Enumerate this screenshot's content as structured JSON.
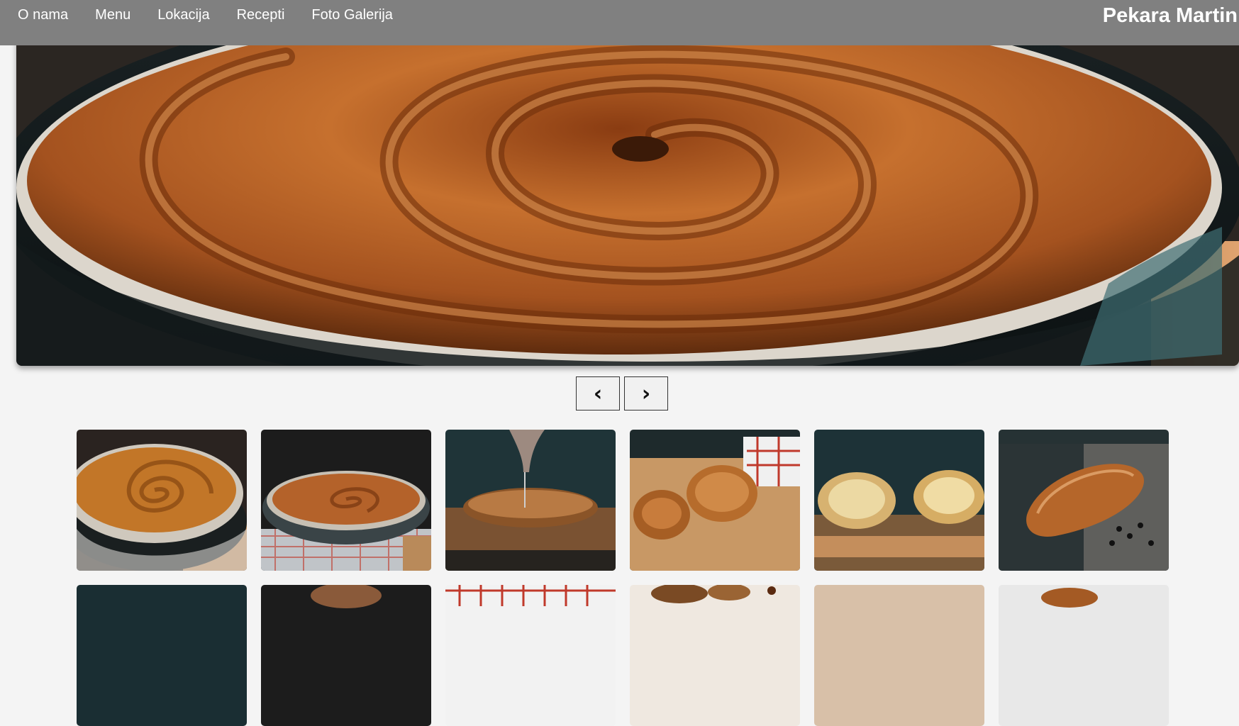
{
  "nav": {
    "items": [
      {
        "label": "O nama"
      },
      {
        "label": "Menu"
      },
      {
        "label": "Lokacija"
      },
      {
        "label": "Recepti"
      },
      {
        "label": "Foto Galerija"
      }
    ],
    "brand": "Pekara Martin"
  },
  "slider": {
    "prev_label": "‹",
    "next_label": "›"
  },
  "gallery": {
    "items": [
      {
        "icon": "spiral-burek-pan-photo"
      },
      {
        "icon": "burek-in-pan-photo"
      },
      {
        "icon": "cutting-pastry-photo"
      },
      {
        "icon": "pastries-on-board-photo"
      },
      {
        "icon": "croissants-on-board-photo"
      },
      {
        "icon": "bread-loaf-photo"
      },
      {
        "icon": "dark-photo"
      },
      {
        "icon": "bread-photo"
      },
      {
        "icon": "checkered-cloth-photo"
      },
      {
        "icon": "bakery-items-photo"
      },
      {
        "icon": "beige-photo"
      },
      {
        "icon": "pastry-photo"
      }
    ]
  },
  "colors": {
    "topbar": "#808080",
    "page_bg": "#f4f4f4",
    "crust": "#b8652a",
    "pan": "#2a3a3c"
  }
}
